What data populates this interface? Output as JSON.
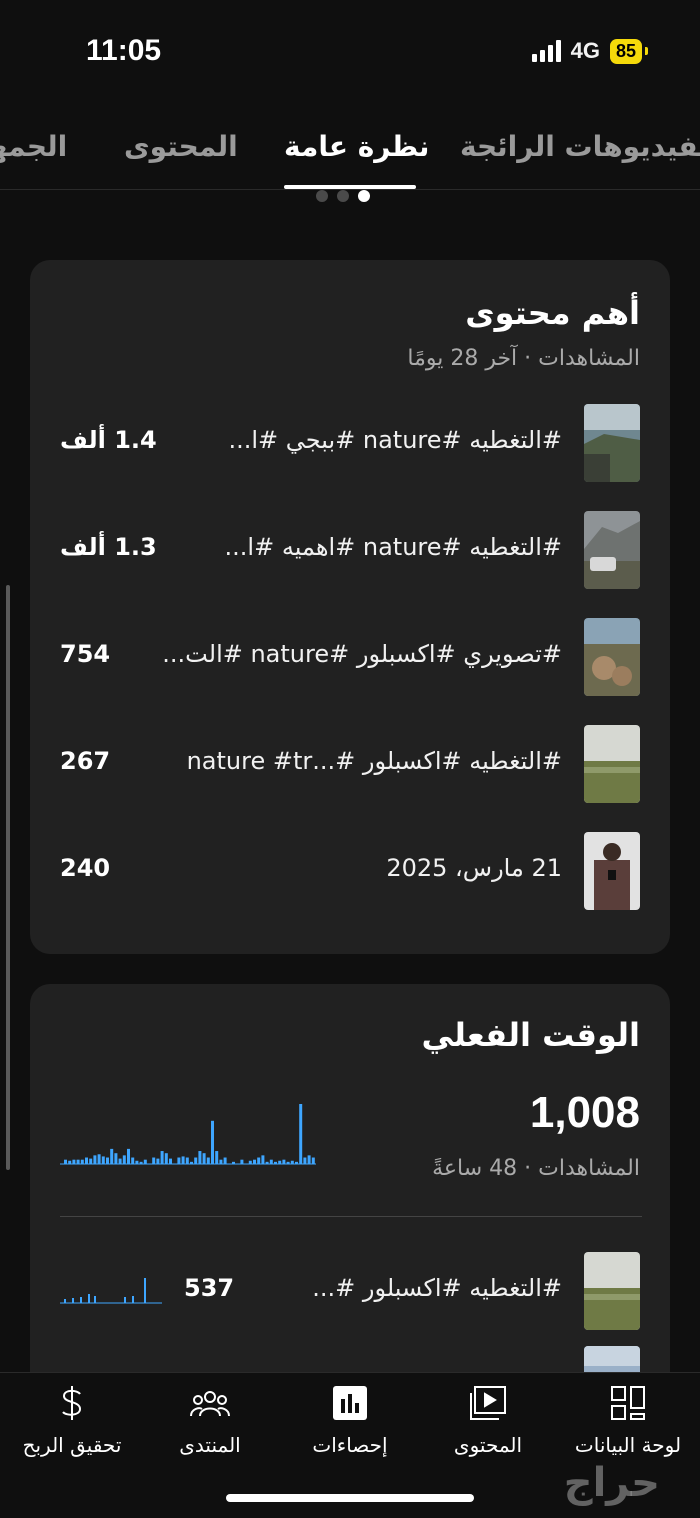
{
  "status": {
    "time": "11:05",
    "network": "4G",
    "battery": "85"
  },
  "tabs": [
    {
      "label": "الفيديوهات الرائجة"
    },
    {
      "label": "نظرة عامة"
    },
    {
      "label": "المحتوى"
    },
    {
      "label": "الجمهور"
    }
  ],
  "top_content": {
    "title": "أهم محتوى",
    "subtitle": "المشاهدات · آخر 28 يومًا",
    "items": [
      {
        "title": "#التغطيه #nature #ببجي #ا...",
        "value": "1.4 ألف"
      },
      {
        "title": "#التغطيه #nature #اهميه #ا...",
        "value": "1.3 ألف"
      },
      {
        "title": "#تصويري #اكسبلور #nature #الت...",
        "value": "754"
      },
      {
        "title": "#التغطيه #اكسبلور #...nature #tr",
        "value": "267"
      },
      {
        "title": "21 مارس، 2025",
        "value": "240"
      }
    ]
  },
  "realtime": {
    "title": "الوقت الفعلي",
    "total": "1,008",
    "subtitle": "المشاهدات · 48 ساعةً",
    "items": [
      {
        "title": "#التغطيه #اكسبلور #...",
        "value": "537"
      }
    ]
  },
  "bottom_nav": [
    {
      "label": "لوحة البيانات",
      "icon": "dashboard-icon"
    },
    {
      "label": "المحتوى",
      "icon": "content-icon"
    },
    {
      "label": "إحصاءات",
      "icon": "analytics-icon"
    },
    {
      "label": "المنتدى",
      "icon": "community-icon"
    },
    {
      "label": "تحقيق الربح",
      "icon": "dollar-icon"
    }
  ],
  "watermark": "حراج",
  "colors": {
    "background": "#0f0f0f",
    "card": "#212121",
    "chart_bar": "#3ea6ff",
    "battery": "#f5d90a"
  }
}
